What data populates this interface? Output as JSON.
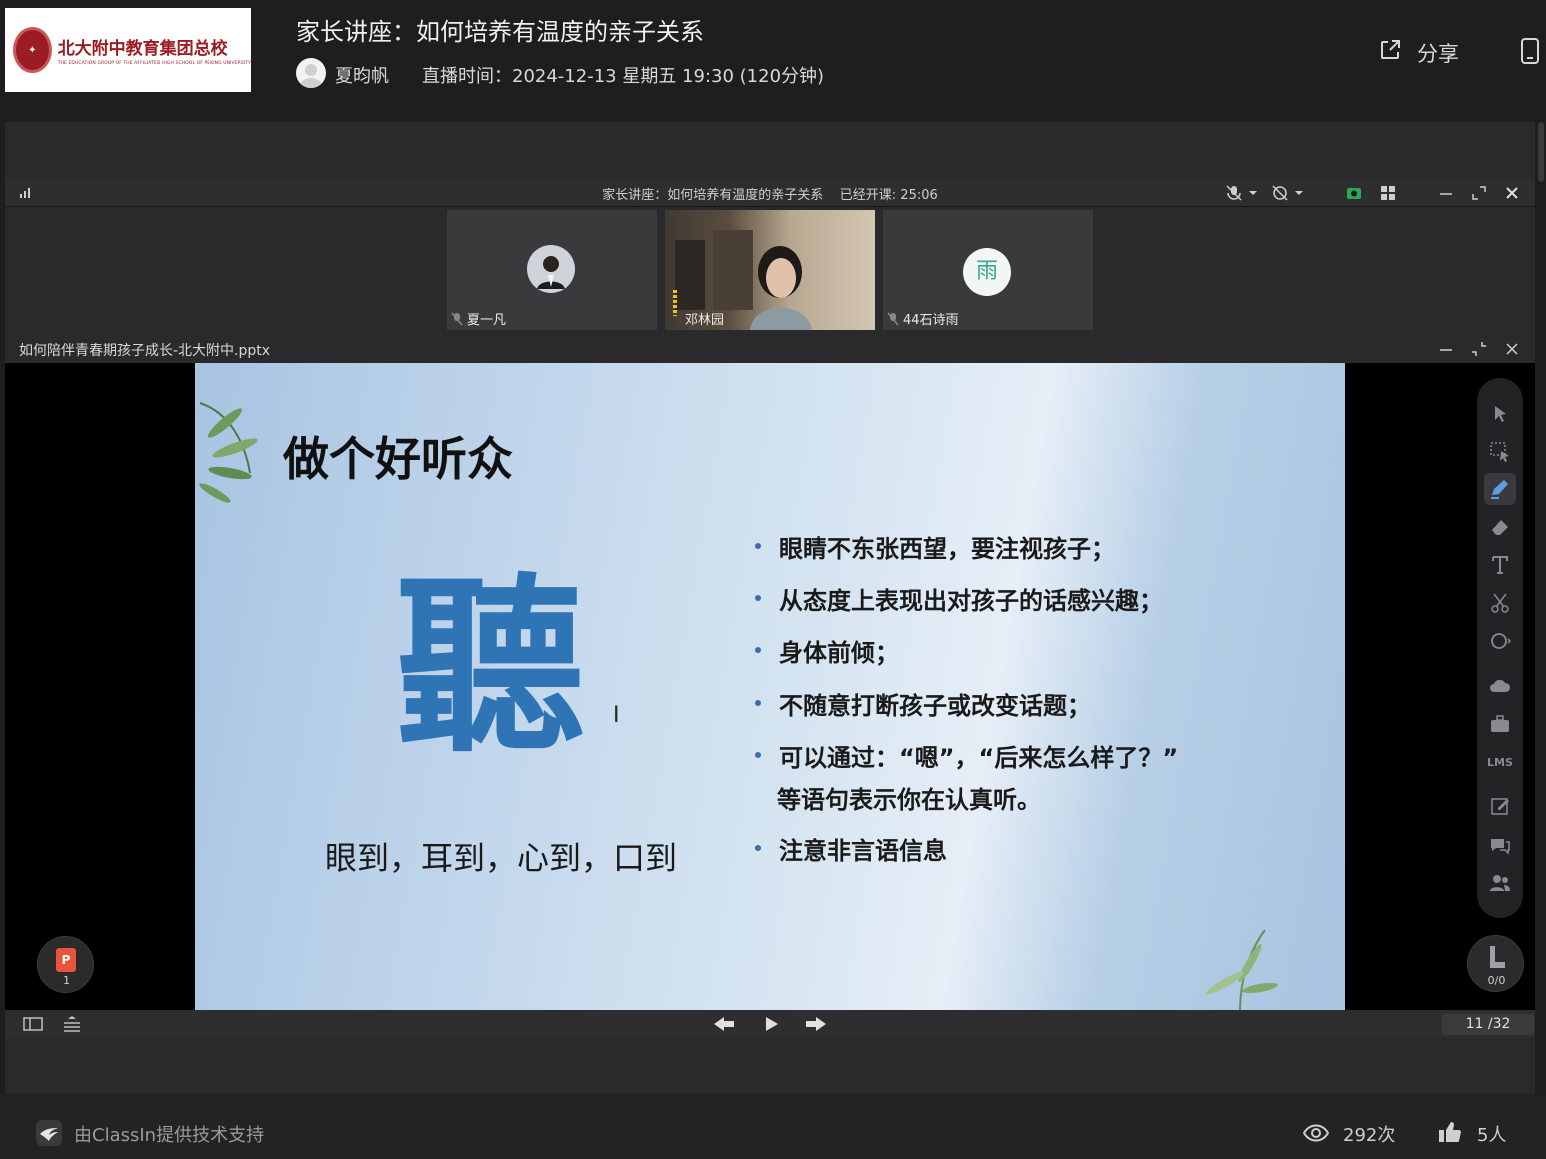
{
  "header": {
    "logo_text": "北大附中教育集团总校",
    "logo_subtext": "THE EDUCATION GROUP OF THE AFFILIATED HIGH SCHOOL OF PEKING UNIVERSITY",
    "title": "家长讲座：如何培养有温度的亲子关系",
    "host": "夏昀帆",
    "schedule": "直播时间：2024-12-13 星期五 19:30 (120分钟)",
    "share_label": "分享"
  },
  "classroom": {
    "title": "家长讲座：如何培养有温度的亲子关系",
    "elapsed": "已经开课: 25:06"
  },
  "participants": [
    {
      "name": "夏一凡"
    },
    {
      "name": "邓林园"
    },
    {
      "name": "44石诗雨",
      "initial": "雨"
    }
  ],
  "document": {
    "filename": "如何陪伴青春期孩子成长-北大附中.pptx"
  },
  "slide": {
    "heading": "做个好听众",
    "big_char": "聽",
    "subtitle": "眼到，耳到，心到，口到",
    "bullets": [
      "眼睛不东张西望，要注视孩子；",
      "从态度上表现出对孩子的话感兴趣；",
      "身体前倾；",
      "不随意打断孩子或改变话题；",
      "可以通过：“嗯”，“后来怎么样了？”",
      "注意非言语信息"
    ],
    "bullet_continuation": "等语句表示你在认真听。"
  },
  "tools": {
    "lms_label": "LMS",
    "handraise_count": "0/0",
    "ppt_badge": "P",
    "ppt_count": "1"
  },
  "navigation": {
    "page_counter": "11 /32"
  },
  "footer": {
    "powered_by": "由ClassIn提供技术支持",
    "views": "292次",
    "likes": "5人"
  },
  "colors": {
    "accent_blue": "#2f74b5",
    "brand_red": "#9b1c22",
    "ppt_orange": "#e8553c",
    "avatar_teal": "#3aa88a"
  }
}
